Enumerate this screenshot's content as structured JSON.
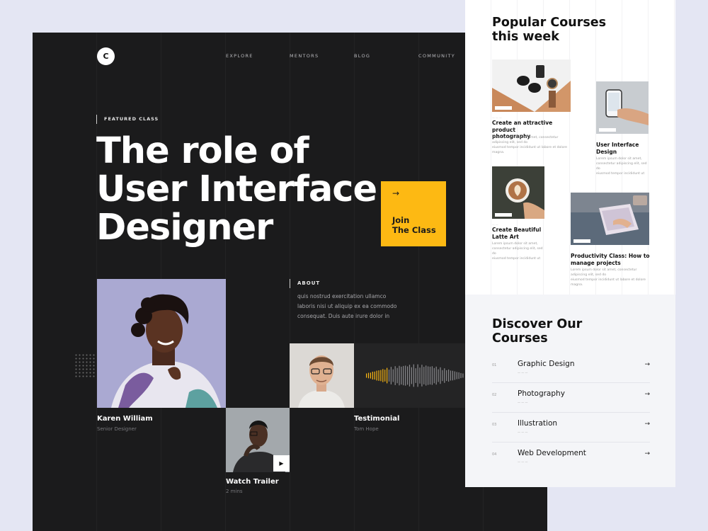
{
  "nav": {
    "logo": "C",
    "items": [
      "EXPLORE",
      "MENTORS",
      "BLOG",
      "COMMUNITY"
    ]
  },
  "hero": {
    "eyebrow": "FEATURED CLASS",
    "title_line1": "The role of",
    "title_line2": "User Interface",
    "title_line3": "Designer"
  },
  "join": {
    "line1": "Join",
    "line2": "The Class"
  },
  "about": {
    "heading": "ABOUT",
    "text": "quis nostrud exercitation ullamco laboris nisi ut aliquip ex ea commodo consequat. Duis aute irure dolor in"
  },
  "people": {
    "karen_name": "Karen William",
    "karen_role": "Senior Designer",
    "trailer_title": "Watch Trailer",
    "trailer_length": "2 mins",
    "testimonial_title": "Testimonial",
    "testimonial_name": "Tom Hope"
  },
  "popular": {
    "title_line1": "Popular Courses",
    "title_line2": "this week",
    "courses": [
      {
        "title_line1": "Create an attractive product",
        "title_line2": "photography",
        "desc_line1": "Lorem ipsum dolor sit amet, consectetur adipiscing elit, sed do",
        "desc_line2": "eiusmod tempor incididunt ut labore et dolore magna."
      },
      {
        "title_line1": "User Interface",
        "title_line2": "Design",
        "desc_line1": "Lorem ipsum dolor sit amet, consectetur adipiscing elit, sed do",
        "desc_line2": "eiusmod tempor incididunt ut"
      },
      {
        "title_line1": "Create Beautiful",
        "title_line2": "Latte Art",
        "desc_line1": "Lorem ipsum dolor sit amet, consectetur adipiscing elit, sed do",
        "desc_line2": "eiusmod tempor incididunt ut"
      },
      {
        "title_line1": "Productivity Class: How to",
        "title_line2": "manage projects",
        "desc_line1": "Lorem ipsum dolor sit amet, consectetur adipiscing elit, sed do",
        "desc_line2": "eiusmod tempor incididunt ut labore et dolore magna."
      }
    ]
  },
  "discover": {
    "title_line1": "Discover Our",
    "title_line2": "Courses",
    "items": [
      {
        "num": "01",
        "name": "Graphic Design"
      },
      {
        "num": "02",
        "name": "Photography"
      },
      {
        "num": "03",
        "name": "Illustration"
      },
      {
        "num": "04",
        "name": "Web Development"
      }
    ]
  },
  "colors": {
    "accent": "#fdb913",
    "dark": "#1b1b1c",
    "light_bg": "#f4f5f8",
    "page_bg": "#e4e6f3"
  }
}
